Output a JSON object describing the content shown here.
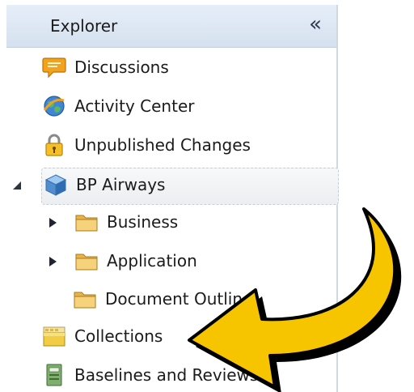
{
  "panel": {
    "title": "Explorer",
    "collapse_glyph": "«"
  },
  "tree": {
    "discussions": "Discussions",
    "activity_center": "Activity Center",
    "unpublished_changes": "Unpublished Changes",
    "bp_airways": "BP Airways",
    "business": "Business",
    "application": "Application",
    "document_outline": "Document Outline",
    "collections": "Collections",
    "baselines": "Baselines and Reviews"
  },
  "icons": {
    "discussions": "speech-bubble-icon",
    "activity_center": "globe-icon",
    "unpublished_changes": "lock-icon",
    "bp_airways": "cube-icon",
    "folder": "folder-icon",
    "collections": "collection-box-icon",
    "baselines": "book-icon"
  },
  "colors": {
    "header_bg": "#d5e1ef",
    "arrow_fill": "#f7c400",
    "arrow_outline": "#000000"
  }
}
